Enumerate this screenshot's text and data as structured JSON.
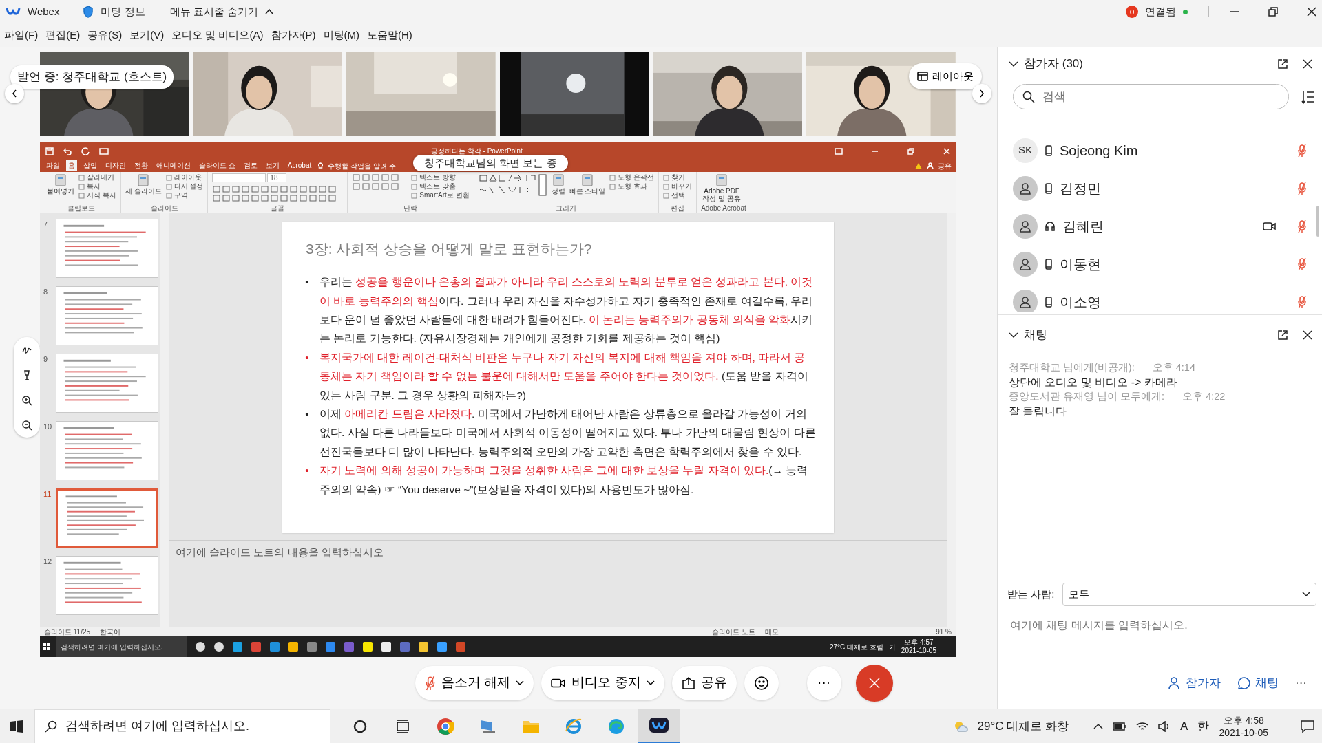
{
  "title_bar": {
    "app": "Webex",
    "meeting_info": "미팅 정보",
    "hide_menu": "메뉴 표시줄 숨기기",
    "badge": "o",
    "status": "연결됨"
  },
  "menu": [
    "파일(F)",
    "편집(E)",
    "공유(S)",
    "보기(V)",
    "오디오 및 비디오(A)",
    "참가자(P)",
    "미팅(M)",
    "도움말(H)"
  ],
  "video_strip": {
    "speaker": "발언 중: 청주대학교 (호스트)",
    "layout": "레이아웃"
  },
  "shared_screen": {
    "sharing_label": "청주대학교님의 화면 보는 중",
    "app_title": "공정하다는 착각 - PowerPoint",
    "ribbon_tabs": [
      {
        "label": "파일",
        "selected": false
      },
      {
        "label": "홈",
        "selected": true
      },
      {
        "label": "삽입",
        "selected": false
      },
      {
        "label": "디자인",
        "selected": false
      },
      {
        "label": "전환",
        "selected": false
      },
      {
        "label": "애니메이션",
        "selected": false
      },
      {
        "label": "슬라이드 쇼",
        "selected": false
      },
      {
        "label": "검토",
        "selected": false
      },
      {
        "label": "보기",
        "selected": false
      },
      {
        "label": "Acrobat",
        "selected": false
      }
    ],
    "tell_me": "수행할 작업을 알려 주",
    "share": "공유",
    "ribbon_groups": [
      {
        "label": "클립보드",
        "items": [
          {
            "kind": "large",
            "label": "붙여넣기"
          },
          {
            "kind": "small",
            "labels": [
              "잘라내기",
              "복사",
              "서식 복사"
            ]
          }
        ]
      },
      {
        "label": "슬라이드",
        "items": [
          {
            "kind": "large",
            "label": "새 슬라이드"
          },
          {
            "kind": "small",
            "labels": [
              "레이아웃",
              "다시 설정",
              "구역"
            ]
          }
        ]
      },
      {
        "label": "글꼴",
        "items": [
          {
            "kind": "font",
            "size": "18"
          }
        ]
      },
      {
        "label": "단락",
        "items": [
          {
            "kind": "paragraph"
          },
          {
            "kind": "small",
            "labels": [
              "텍스트 방향",
              "텍스트 맞춤",
              "SmartArt로 변환"
            ]
          }
        ]
      },
      {
        "label": "그리기",
        "items": [
          {
            "kind": "shapes"
          },
          {
            "kind": "large",
            "label": "정렬"
          },
          {
            "kind": "large",
            "label": "빠른 스타일"
          },
          {
            "kind": "small",
            "labels": [
              "도형 윤곽선",
              "도형 효과"
            ]
          }
        ]
      },
      {
        "label": "편집",
        "items": [
          {
            "kind": "small",
            "labels": [
              "찾기",
              "바꾸기",
              "선택"
            ]
          }
        ]
      },
      {
        "label": "Adobe Acrobat",
        "items": [
          {
            "kind": "large",
            "label": "Adobe PDF 작성 및 공유"
          }
        ]
      }
    ],
    "thumbnails": [
      {
        "number": "7",
        "selected": false
      },
      {
        "number": "8",
        "selected": false
      },
      {
        "number": "9",
        "selected": false
      },
      {
        "number": "10",
        "selected": false
      },
      {
        "number": "11",
        "selected": true
      },
      {
        "number": "12",
        "selected": false
      }
    ],
    "slide": {
      "title": "3장: 사회적 상승을 어떻게 말로 표현하는가?",
      "bullets": [
        {
          "marker": "•",
          "emphasis": false,
          "runs": [
            {
              "text": "우리는 ",
              "emphasis": false
            },
            {
              "text": "성공을 행운이나 은총의 결과가 아니라 우리 스스로의 노력의 분투로 얻은 성과라고 본다. 이것이 바로 능력주의의 핵심",
              "emphasis": true
            },
            {
              "text": "이다. 그러나 우리 자신을 자수성가하고 자기 충족적인 존재로 여길수록, 우리보다 운이 덜 좋았던 사람들에 대한 배려가 힘들어진다. ",
              "emphasis": false
            },
            {
              "text": "이 논리는 능력주의가 공동체 의식을 악화",
              "emphasis": true
            },
            {
              "text": "시키는 논리로 기능한다. (자유시장경제는 개인에게 공정한 기회를 제공하는 것이 핵심)",
              "emphasis": false
            }
          ]
        },
        {
          "marker": "•",
          "emphasis": true,
          "runs": [
            {
              "text": "복지국가에 대한 레이건-대처식 비판은 누구나 자기 자신의 복지에 대해 책임을 져야 하며, 따라서 공동체는 자기 책임이라 할 수 없는 불운에 대해서만 도움을 주어야 한다는 것이었다.",
              "emphasis": true
            },
            {
              "text": " (도움 받을 자격이 있는 사람 구분. 그 경우 상황의 피해자는?)",
              "emphasis": false
            }
          ]
        },
        {
          "marker": "•",
          "emphasis": false,
          "runs": [
            {
              "text": "이제 ",
              "emphasis": false
            },
            {
              "text": "아메리칸 드림은 사라졌다",
              "emphasis": true
            },
            {
              "text": ". 미국에서 가난하게 태어난 사람은 상류층으로 올라갈 가능성이 거의 없다. 사실 다른 나라들보다 미국에서 사회적 이동성이 떨어지고 있다. 부나 가난의 대물림 현상이 다른 선진국들보다 더 많이 나타난다. 능력주의적 오만의 가장 고약한 측면은 학력주의에서 찾을 수 있다.",
              "emphasis": false
            }
          ]
        },
        {
          "marker": "•",
          "emphasis": true,
          "runs": [
            {
              "text": "자기 노력에 의해 성공이 가능하며 그것을 성취한 사람은 그에 대한 보상을 누릴 자격이 있다.",
              "emphasis": true
            },
            {
              "text": "(→ 능력주의의 약속) ☞ “You deserve ~”(보상받을 자격이 있다)의 사용빈도가 많아짐.",
              "emphasis": false
            }
          ]
        }
      ]
    },
    "notes_placeholder": "여기에 슬라이드 노트의 내용을 입력하십시오",
    "status_bar": {
      "slide_position": "슬라이드 11/25",
      "language": "한국어",
      "notes": "슬라이드 노트",
      "comments": "메모",
      "zoom": "91 %"
    },
    "taskbar": {
      "search_placeholder": "검색하려면 여기에 입력하십시오.",
      "weather": "27°C 대체로 흐림",
      "ime": "가",
      "time": "오후 4:57",
      "date": "2021-10-05"
    }
  },
  "participants": {
    "title": "참가자 (30)",
    "search_placeholder": "검색",
    "rows": [
      {
        "avatar": {
          "kind": "initials",
          "initials": "SK"
        },
        "device": {
          "kind": "phone"
        },
        "name": "Sojeong Kim",
        "video": false,
        "muted": true
      },
      {
        "avatar": {
          "kind": "person"
        },
        "device": {
          "kind": "phone"
        },
        "name": "김정민",
        "video": false,
        "muted": true
      },
      {
        "avatar": {
          "kind": "person"
        },
        "device": {
          "kind": "headset"
        },
        "name": "김혜린",
        "video": true,
        "muted": true
      },
      {
        "avatar": {
          "kind": "person"
        },
        "device": {
          "kind": "phone"
        },
        "name": "이동현",
        "video": false,
        "muted": true
      },
      {
        "avatar": {
          "kind": "person"
        },
        "device": {
          "kind": "phone"
        },
        "name": "이소영",
        "video": false,
        "muted": true
      }
    ]
  },
  "chat": {
    "title": "채팅",
    "messages": [
      {
        "sender": "청주대학교 님에게(비공개):",
        "time": "오후 4:14",
        "text": "상단에 오디오 및 비디오 -> 카메라"
      },
      {
        "sender": "중앙도서관 유재영 님이 모두에게:",
        "time": "오후 4:22",
        "text": "잘 들립니다"
      }
    ],
    "recipient_label": "받는 사람:",
    "recipient": "모두",
    "placeholder": "여기에 채팅 메시지를 입력하십시오."
  },
  "controls": [
    {
      "kind": "mute",
      "label": "음소거 해제",
      "caret": true
    },
    {
      "kind": "video",
      "label": "비디오 중지",
      "caret": true
    },
    {
      "kind": "share",
      "label": "공유",
      "caret": false
    },
    {
      "kind": "reactions",
      "caret": false
    },
    {
      "kind": "more",
      "label": "···",
      "caret": false
    },
    {
      "kind": "end",
      "caret": false
    }
  ],
  "panel_buttons": [
    {
      "kind": "participants",
      "label": "참가자"
    },
    {
      "kind": "chat",
      "label": "채팅"
    },
    {
      "kind": "more",
      "label": "···"
    }
  ],
  "taskbar": {
    "search_placeholder": "검색하려면 여기에 입력하십시오.",
    "apps": [
      {
        "kind": "cortana",
        "selected": false
      },
      {
        "kind": "taskview",
        "selected": false
      },
      {
        "kind": "chrome",
        "selected": false
      },
      {
        "kind": "computer",
        "selected": false
      },
      {
        "kind": "folder",
        "selected": false
      },
      {
        "kind": "ie",
        "selected": false
      },
      {
        "kind": "edge",
        "selected": false
      },
      {
        "kind": "webex",
        "selected": true
      }
    ],
    "weather": "29°C 대체로 화창",
    "ime_mode": "A",
    "ime_lang": "한",
    "time": "오후 4:58",
    "date": "2021-10-05"
  }
}
